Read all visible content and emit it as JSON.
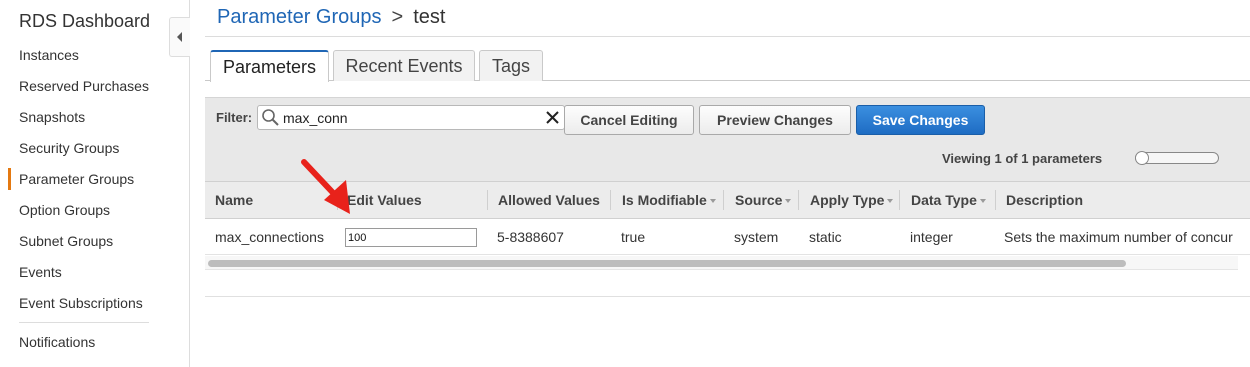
{
  "sidebar": {
    "title": "RDS Dashboard",
    "items": [
      {
        "label": "Instances"
      },
      {
        "label": "Reserved Purchases"
      },
      {
        "label": "Snapshots"
      },
      {
        "label": "Security Groups"
      },
      {
        "label": "Parameter Groups"
      },
      {
        "label": "Option Groups"
      },
      {
        "label": "Subnet Groups"
      },
      {
        "label": "Events"
      },
      {
        "label": "Event Subscriptions"
      },
      {
        "label": "Notifications"
      }
    ],
    "active_item": "Parameter Groups",
    "active_color": "#e47911",
    "collapse_icon": "chevron-left-icon"
  },
  "breadcrumb": {
    "parent": "Parameter Groups",
    "separator": ">",
    "current": "test",
    "link_color": "#1f66b5"
  },
  "tabs": [
    {
      "label": "Parameters",
      "active": true
    },
    {
      "label": "Recent Events",
      "active": false
    },
    {
      "label": "Tags",
      "active": false
    }
  ],
  "toolbar": {
    "filter_label": "Filter:",
    "filter_value": "max_conn",
    "search_icon": "search-icon",
    "clear_icon": "close-icon",
    "cancel_label": "Cancel Editing",
    "preview_label": "Preview Changes",
    "save_label": "Save Changes",
    "primary_color": "#1e6cc3",
    "viewing_text": "Viewing 1 of 1 parameters"
  },
  "table": {
    "columns": [
      {
        "label": "Name",
        "sortable": false
      },
      {
        "label": "Edit Values",
        "sortable": false
      },
      {
        "label": "Allowed Values",
        "sortable": false
      },
      {
        "label": "Is Modifiable",
        "sortable": true
      },
      {
        "label": "Source",
        "sortable": true
      },
      {
        "label": "Apply Type",
        "sortable": true
      },
      {
        "label": "Data Type",
        "sortable": true
      },
      {
        "label": "Description",
        "sortable": false
      }
    ],
    "rows": [
      {
        "name": "max_connections",
        "edit_value": "100",
        "allowed_values": "5-8388607",
        "is_modifiable": "true",
        "source": "system",
        "apply_type": "static",
        "data_type": "integer",
        "description": "Sets the maximum number of concur"
      }
    ]
  },
  "annotation": {
    "arrow_color": "#e8221b"
  }
}
